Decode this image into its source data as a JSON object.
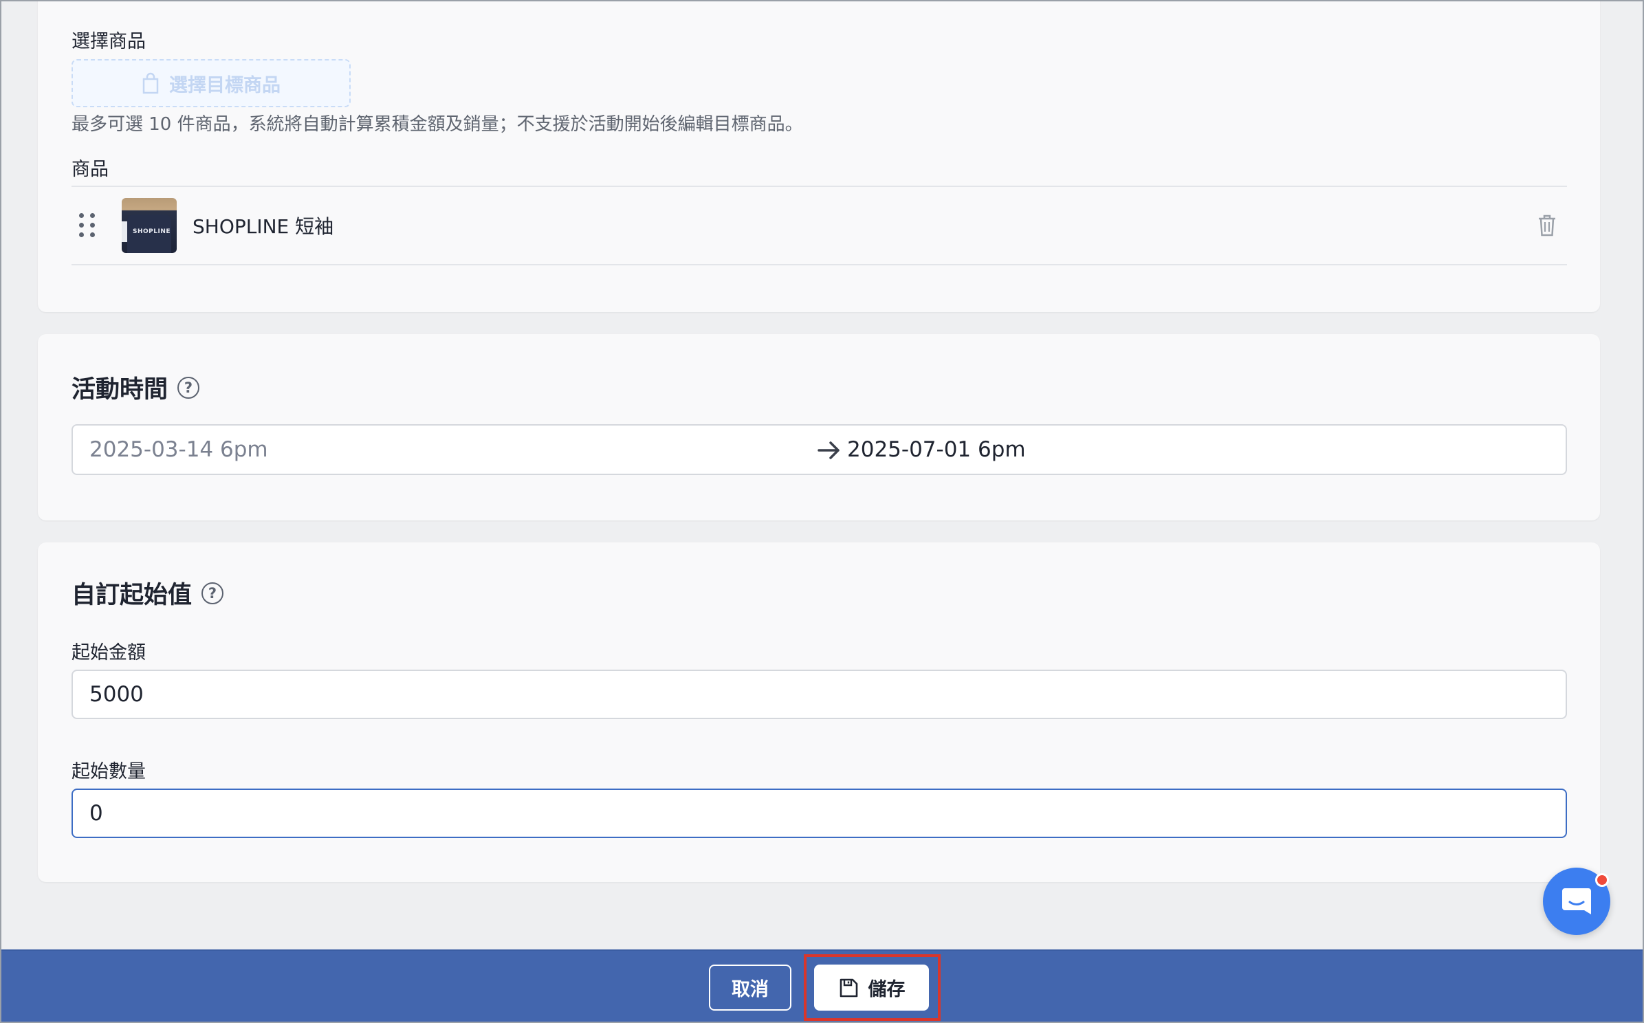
{
  "products_section": {
    "select_label": "選擇商品",
    "select_button_label": "選擇目標商品",
    "hint": "最多可選 10 件商品，系統將自動計算累積金額及銷量；不支援於活動開始後編輯目標商品。",
    "list_header": "商品",
    "items": [
      {
        "name": "SHOPLINE 短袖",
        "thumb_text": "SHOPLINE"
      }
    ]
  },
  "time_section": {
    "title": "活動時間",
    "help": "?",
    "start": "2025-03-14 6pm",
    "end": "2025-07-01 6pm"
  },
  "start_value_section": {
    "title": "自訂起始值",
    "help": "?",
    "amount_label": "起始金額",
    "amount_value": "5000",
    "quantity_label": "起始數量",
    "quantity_value": "0"
  },
  "footer": {
    "cancel_label": "取消",
    "save_label": "儲存"
  },
  "colors": {
    "primary_bar": "#4366ae",
    "highlight": "#d9362b",
    "chat": "#3c7ef0"
  },
  "icons": {
    "select_button": "shopping-bag-icon",
    "delete": "trash-icon",
    "drag": "drag-handle-icon",
    "arrow": "arrow-right-icon",
    "save": "floppy-disk-icon",
    "chat": "chat-icon"
  }
}
